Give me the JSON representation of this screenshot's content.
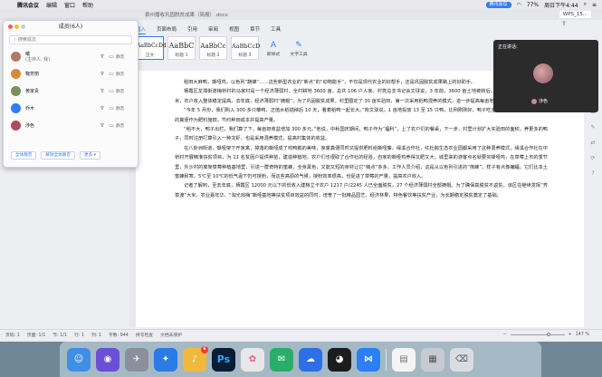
{
  "menubar": {
    "app_name": "腾讯会议",
    "items": [
      "编辑",
      "窗口",
      "帮助"
    ],
    "meeting_pill": "腾讯会议",
    "battery": "77%",
    "datetime": "周日下午4:44"
  },
  "window": {
    "title": "泉州播收巩固脱贫成果（简报）.docx",
    "wps_tab": "WPS_15..."
  },
  "ribbon": {
    "tabs": [
      "插入",
      "页面布局",
      "引用",
      "审阅",
      "视图",
      "章节",
      "工具"
    ],
    "active_tab": "插入",
    "styles": [
      {
        "sample": "AaBbCcDd",
        "name": "正文"
      },
      {
        "sample": "AaBbC",
        "name": "标题 1"
      },
      {
        "sample": "AaBbCc",
        "name": "标题 2"
      },
      {
        "sample": "AaBbCcD",
        "name": "标题 3"
      }
    ],
    "new_style_label": "新样式",
    "text_tool_label": "文字工具"
  },
  "members": {
    "title": "成员(6人)",
    "search_placeholder": "搜索成员",
    "list": [
      {
        "name": "曦",
        "sub": "(主持人, 我)",
        "action": "静音",
        "color": "#b07a6a"
      },
      {
        "name": "鞠芳丽",
        "sub": "",
        "action": "静音",
        "color": "#d9893a"
      },
      {
        "name": "黄家贵",
        "sub": "",
        "action": "静音",
        "color": "#7a8f5a"
      },
      {
        "name": "乔木",
        "sub": "",
        "action": "静音",
        "color": "#2d7ef7"
      },
      {
        "name": "涉色",
        "sub": "",
        "action": "静音",
        "color": "#b04b5c"
      }
    ],
    "btn_mute_all": "全体静音",
    "btn_unmute_all": "解除全体静音",
    "btn_more": "更多 ▾"
  },
  "video": {
    "label": "正在讲话:",
    "speaker": "涉色"
  },
  "document": {
    "paragraphs": [
      "稻田大麻鸭，嘶哑鸡，以色列“蔬蜂”……这些新型农业的“新点”的“动物能手”，不仅是现代农业的好帮手，还是巩固脱贫成果路上的好助手。",
      "栖霞区龙潭街道梅桥村的马家村是一个经济薄弱村，全村耕地 3600 亩，总共 106 户人家。村党总支书记会文球说，3 年前，3600 亩土地被转后，种植当前品牌“芳草渡”大米，农户收入整体稳定提高。去年底，经济薄弱村“摘帽”，为了巩固脱贫成果，村里圈定了 30 亩实验田，第一次采用稻鸭混养的模式，进一步提高每亩地的收益。",
      "“今年 5 月份，我们购入 300 多只雏鸭，正值水稻插秧后 10 天，看着稻鸭一起长大。”俞文球说，1 亩地投放 13 至 15 只鸭，比例刚刚好，鸭子吃虫、除草、辅以饲料，鸭子的粪便作为肥料施田，节约种田成本并提高产量。",
      "“稻不大，鸭子出栏，我们算了下，每亩田收益增加 300 多元。”他说，中秋国庆期间，鸭子作为“福利”，上了农户们的餐桌，下一步，村里计划扩大实验田的面积，养更多的鸭子，同时注册打算引入一种龙虾，也是采用混养模式，提高村集体的收益。",
      "在八卦洲街道，嘶哑架下开家禽，掉落的嘶哑成了鸡鸭鹅的美味，家禽粪便同时又提供肥料给嘶哑藤，缘溪合作社，红杜鹃生态农业园都采用了这种混养模式，缘溪合作社在中桥村开展精准扶贫项目，为 11 名贫困户提供种苗，建造种植地，农户们也很取了合作社的经验，自家的嘶哑鸡养得又肥又大，城里来的游客点名就要买嘶哑鸡，在草莓上市的季节里，外沙村的离架草莓种植基地里，引进一群奇特的蜜蜂，全身黑色，又能又短的身材让它“萌点”多多，工作人员介绍，这是从以色列引进的“熊蜂”，样子有点像蝙蝠，它们比本土蜜蜂耐寒，5℃至 10℃的低气温下仍可授粉，而这些高原的气候，授粉效率很高，也促进了草莓的产量，提高农户收入。",
      "记者了解到，至去年底，栖霞区 12000 元以下的低收入建档立卡农户 1217 户/2245 人已全面脱贫，27 个经济薄弱村全部摘帽。为了确保真脱贫不返贫，该区在继续发挥“芳草渡”大米、农业嘉年华、“淘光戏嗨”嘶哑基地等扶贫项目效益的同时，培育了一批精品园艺、经济林果，特色餐饮等扶贫产业，为长期稳定脱贫奠定了基础。"
    ]
  },
  "statusbar": {
    "page": "页码: 1",
    "pages": "页面: 1/1",
    "section": "节: 1/1",
    "row": "行: 1",
    "column": "列: 1",
    "words": "字数: 944",
    "spell": "拼写检查",
    "protect": "文档未保护",
    "zoom": "147 %"
  },
  "dock": {
    "apps": [
      {
        "name": "finder",
        "glyph": "☺",
        "color": "#3e8fe6",
        "badge": ""
      },
      {
        "name": "siri",
        "glyph": "◉",
        "color": "#6a4fd6",
        "badge": ""
      },
      {
        "name": "launchpad",
        "glyph": "✈",
        "color": "#8a8f99",
        "badge": ""
      },
      {
        "name": "safari",
        "glyph": "✦",
        "color": "#2a7be4",
        "badge": ""
      },
      {
        "name": "qq-music",
        "glyph": "♪",
        "color": "#f2b83a",
        "badge": "6"
      },
      {
        "name": "photoshop",
        "glyph": "Ps",
        "color": "#0b1d35",
        "badge": ""
      },
      {
        "name": "photos",
        "glyph": "✿",
        "color": "#e8e8e8",
        "badge": ""
      },
      {
        "name": "wechat",
        "glyph": "✉",
        "color": "#2aae67",
        "badge": ""
      },
      {
        "name": "baidu-netdisk",
        "glyph": "☁",
        "color": "#2c6fe8",
        "badge": ""
      },
      {
        "name": "qq",
        "glyph": "◕",
        "color": "#1c1c1c",
        "badge": ""
      },
      {
        "name": "tencent-meeting",
        "glyph": "⋈",
        "color": "#2d7ef7",
        "badge": ""
      },
      {
        "name": "document",
        "glyph": "▤",
        "color": "#f4f4f4",
        "badge": ""
      },
      {
        "name": "downloads",
        "glyph": "▦",
        "color": "#c7cbd1",
        "badge": ""
      },
      {
        "name": "trash",
        "glyph": "⌫",
        "color": "#d9dde2",
        "badge": ""
      }
    ]
  }
}
